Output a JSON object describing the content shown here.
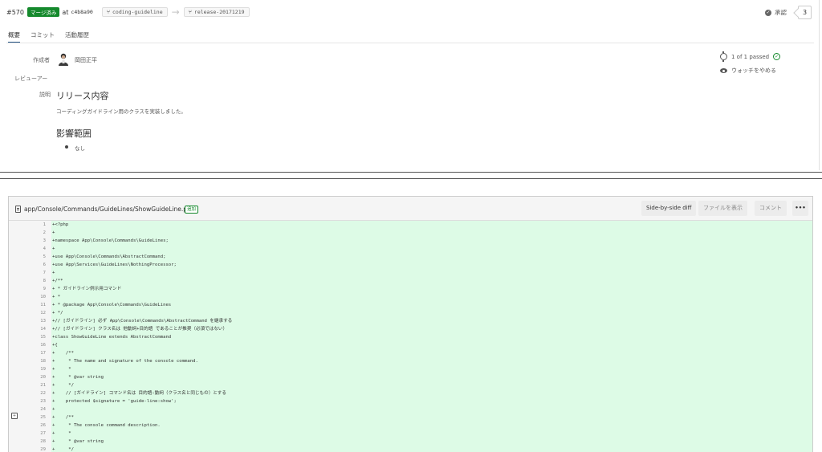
{
  "pr": {
    "number": "#570",
    "merged_badge": "マージ済み",
    "at": "at",
    "commit": "c4b8a90",
    "source_branch": "coding-guideline",
    "target_branch": "release-20171219",
    "approve_label": "承認",
    "approve_count": "3"
  },
  "tabs": [
    "概要",
    "コミット",
    "活動履歴"
  ],
  "overview": {
    "author_label": "作成者",
    "author_name": "岡田正平",
    "reviewer_label": "レビューアー",
    "description_label": "説明",
    "heading_release": "リリース内容",
    "release_text": "コーディングガイドライン用のクラスを実装しました。",
    "heading_impact": "影響範囲",
    "impact_item": "なし",
    "builds": "1 of 1 passed",
    "watch": "ウォッチをやめる"
  },
  "diff": {
    "file_path": "app/Console/Commands/GuideLines/ShowGuideLine.php",
    "added_badge": "追加",
    "btn_side_by_side": "Side-by-side diff",
    "btn_view_file": "ファイルを表示",
    "btn_comment": "コメント",
    "btn_more": "•••",
    "lines": [
      {
        "n": "1",
        "t": "+<?php"
      },
      {
        "n": "2",
        "t": "+"
      },
      {
        "n": "3",
        "t": "+namespace App\\Console\\Commands\\GuideLines;"
      },
      {
        "n": "4",
        "t": "+"
      },
      {
        "n": "5",
        "t": "+use App\\Console\\Commands\\AbstractCommand;"
      },
      {
        "n": "6",
        "t": "+use App\\Services\\GuideLines\\NothingProcessor;"
      },
      {
        "n": "7",
        "t": "+"
      },
      {
        "n": "8",
        "t": "+/**"
      },
      {
        "n": "9",
        "t": "+ * ガイドライン例示用コマンド"
      },
      {
        "n": "10",
        "t": "+ *"
      },
      {
        "n": "11",
        "t": "+ * @package App\\Console\\Commands\\GuideLines"
      },
      {
        "n": "12",
        "t": "+ */"
      },
      {
        "n": "13",
        "t": "+// [ガイドライン] 必ず App\\Console\\Commands\\AbstractCommand を継承する"
      },
      {
        "n": "14",
        "t": "+// [ガイドライン] クラス名は 他動詞+目的語 であることが推奨（必須ではない）"
      },
      {
        "n": "15",
        "t": "+class ShowGuideLine extends AbstractCommand"
      },
      {
        "n": "16",
        "t": "+{"
      },
      {
        "n": "17",
        "t": "+    /**"
      },
      {
        "n": "18",
        "t": "+     * The name and signature of the console command."
      },
      {
        "n": "19",
        "t": "+     *"
      },
      {
        "n": "20",
        "t": "+     * @var string"
      },
      {
        "n": "21",
        "t": "+     */"
      },
      {
        "n": "22",
        "t": "+    // [ガイドライン] コマンド名は 目的語:動詞（クラス名と同じもの）とする"
      },
      {
        "n": "23",
        "t": "+    protected $signature = 'guide-line:show';"
      },
      {
        "n": "24",
        "t": "+"
      },
      {
        "n": "25",
        "t": "+    /**"
      },
      {
        "n": "26",
        "t": "+     * The console command description."
      },
      {
        "n": "27",
        "t": "+     *"
      },
      {
        "n": "28",
        "t": "+     * @var string"
      },
      {
        "n": "29",
        "t": "+     */"
      }
    ]
  }
}
